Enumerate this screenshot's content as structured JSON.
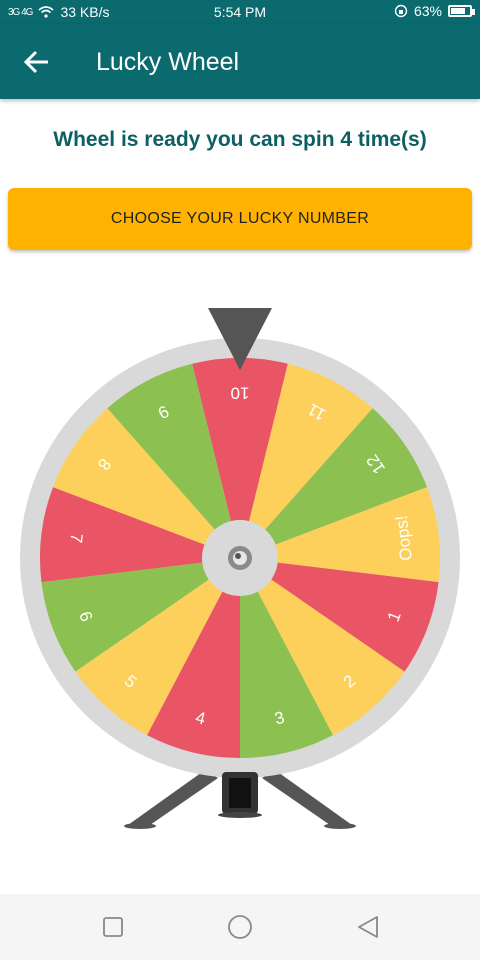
{
  "status_bar": {
    "signal": "3G  4G",
    "net_speed": "33 KB/s",
    "time": "5:54 PM",
    "battery": "63%"
  },
  "app_bar": {
    "title": "Lucky Wheel",
    "back_icon": "arrow-back-icon"
  },
  "main": {
    "ready_text": "Wheel is ready you can spin 4 time(s)",
    "choose_button_label": "CHOOSE YOUR LUCKY NUMBER"
  },
  "wheel": {
    "segments": [
      {
        "label": "10",
        "color": "#ea5566"
      },
      {
        "label": "11",
        "color": "#fcd05a"
      },
      {
        "label": "12",
        "color": "#8cc152"
      },
      {
        "label": "Oops!",
        "color": "#fcd05a"
      },
      {
        "label": "1",
        "color": "#ea5566"
      },
      {
        "label": "2",
        "color": "#fcd05a"
      },
      {
        "label": "3",
        "color": "#8cc152"
      },
      {
        "label": "4",
        "color": "#ea5566"
      },
      {
        "label": "5",
        "color": "#fcd05a"
      },
      {
        "label": "6",
        "color": "#8cc152"
      },
      {
        "label": "7",
        "color": "#ea5566"
      },
      {
        "label": "8",
        "color": "#fcd05a"
      },
      {
        "label": "9",
        "color": "#8cc152"
      }
    ],
    "rim_color": "#d9d9d9",
    "pointer_color": "#555555"
  },
  "nav_bar": {
    "recent_icon": "square-recent-icon",
    "home_icon": "circle-home-icon",
    "back_icon": "triangle-back-icon"
  },
  "colors": {
    "primary": "#0a6a6e",
    "accent": "#ffb300",
    "title_text": "#0d5f63"
  }
}
